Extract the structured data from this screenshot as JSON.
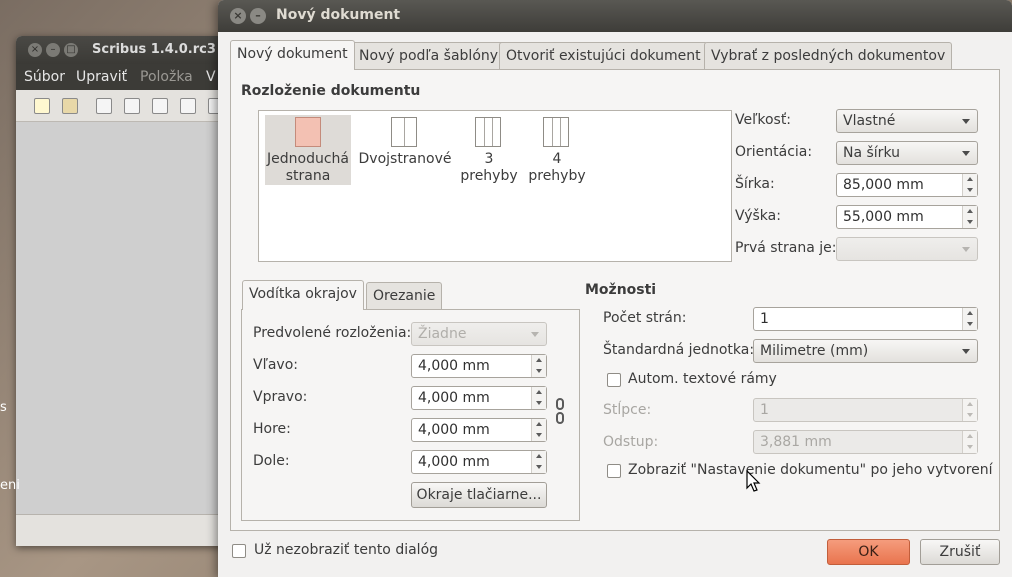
{
  "background_app": {
    "title": "Scribus 1.4.0.rc3",
    "menu": [
      "Súbor",
      "Upraviť",
      "Položka",
      "V"
    ],
    "edge_text": [
      "s",
      "eni"
    ]
  },
  "dialog": {
    "title": "Nový dokument",
    "tabs": [
      "Nový dokument",
      "Nový podľa šablóny",
      "Otvoriť existujúci dokument",
      "Vybrať z posledných dokumentov"
    ],
    "layout_section": {
      "title": "Rozloženie dokumentu",
      "items": [
        {
          "line1": "Jednoduchá",
          "line2": "strana",
          "icon": "single-page-icon"
        },
        {
          "line1": "Dvojstranové",
          "line2": "",
          "icon": "double-page-icon"
        },
        {
          "line1": "3",
          "line2": "prehyby",
          "icon": "three-fold-icon"
        },
        {
          "line1": "4",
          "line2": "prehyby",
          "icon": "four-fold-icon"
        }
      ]
    },
    "page": {
      "size_label": "Veľkosť:",
      "size_value": "Vlastné",
      "orientation_label": "Orientácia:",
      "orientation_value": "Na šírku",
      "width_label": "Šírka:",
      "width_value": "85,000 mm",
      "height_label": "Výška:",
      "height_value": "55,000 mm",
      "first_page_label": "Prvá strana je:",
      "first_page_value": ""
    },
    "margins": {
      "tabs": [
        "Vodítka okrajov",
        "Orezanie"
      ],
      "preset_label": "Predvolené rozloženia:",
      "preset_value": "Žiadne",
      "left_label": "Vľavo:",
      "left_value": "4,000 mm",
      "right_label": "Vpravo:",
      "right_value": "4,000 mm",
      "top_label": "Hore:",
      "top_value": "4,000 mm",
      "bottom_label": "Dole:",
      "bottom_value": "4,000 mm",
      "printer_margins_button": "Okraje tlačiarne..."
    },
    "options": {
      "title": "Možnosti",
      "pages_label": "Počet strán:",
      "pages_value": "1",
      "unit_label": "Štandardná jednotka:",
      "unit_value": "Milimetre (mm)",
      "auto_frames_label": "Autom. textové rámy",
      "columns_label": "Stĺpce:",
      "columns_value": "1",
      "gap_label": "Odstup:",
      "gap_value": "3,881 mm",
      "show_settings_label": "Zobraziť \"Nastavenie dokumentu\" po jeho vytvorení"
    },
    "dont_show_label": "Už nezobraziť tento dialóg",
    "ok_label": "OK",
    "cancel_label": "Zrušiť"
  }
}
